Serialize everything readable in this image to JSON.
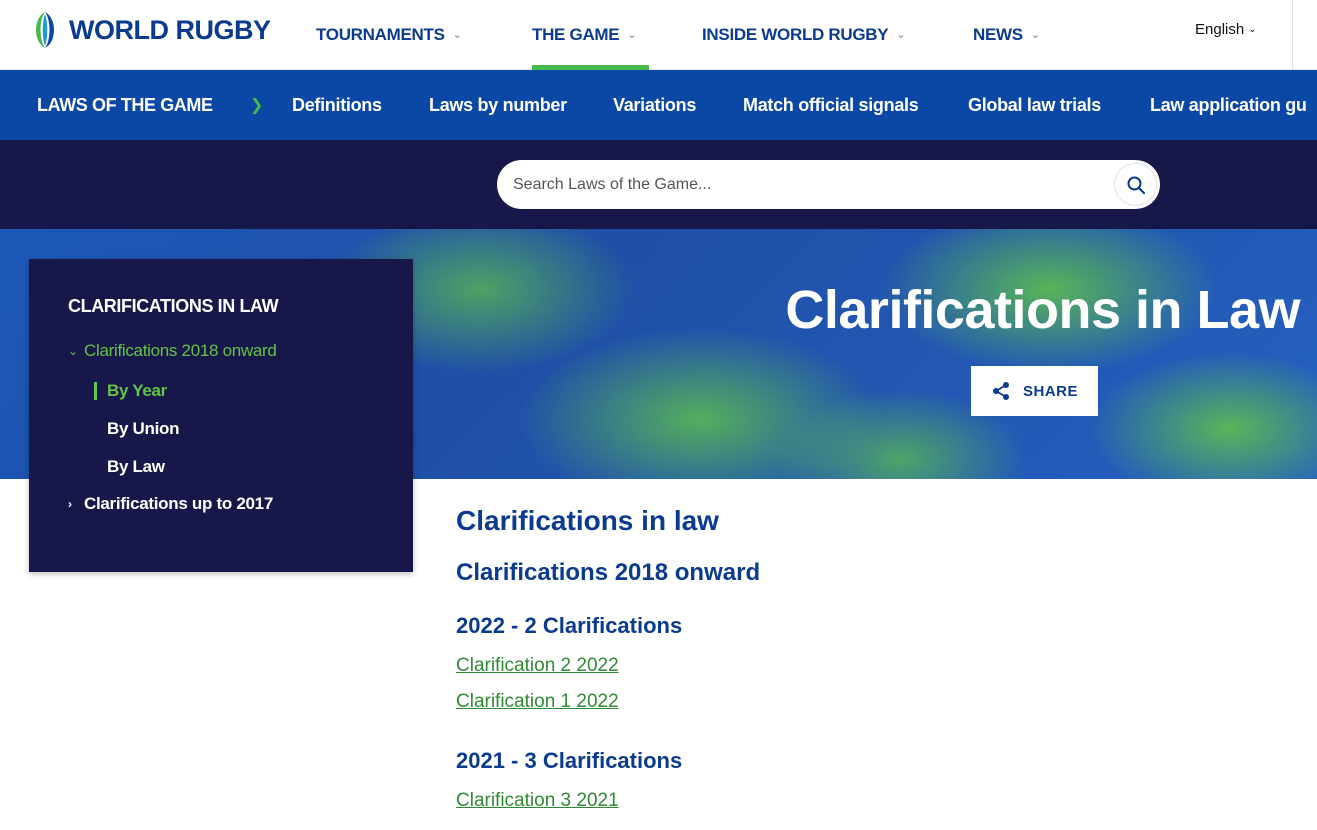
{
  "header": {
    "logo_text": "WORLD RUGBY",
    "nav": [
      {
        "label": "TOURNAMENTS"
      },
      {
        "label": "THE GAME"
      },
      {
        "label": "INSIDE WORLD RUGBY"
      },
      {
        "label": "NEWS"
      }
    ],
    "language": "English"
  },
  "laws_nav": {
    "title": "LAWS OF THE GAME",
    "links": [
      {
        "label": "Definitions"
      },
      {
        "label": "Laws by number"
      },
      {
        "label": "Variations"
      },
      {
        "label": "Match official signals"
      },
      {
        "label": "Global law trials"
      },
      {
        "label": "Law application gu"
      }
    ]
  },
  "search": {
    "placeholder": "Search Laws of the Game..."
  },
  "hero": {
    "title": "Clarifications in Law",
    "share_label": "SHARE"
  },
  "sidebar": {
    "title": "CLARIFICATIONS IN LAW",
    "items": [
      {
        "label": "Clarifications 2018 onward"
      },
      {
        "label": "By Year"
      },
      {
        "label": "By Union"
      },
      {
        "label": "By Law"
      },
      {
        "label": "Clarifications up to 2017"
      }
    ]
  },
  "content": {
    "title": "Clarifications in law",
    "subtitle": "Clarifications 2018 onward",
    "groups": [
      {
        "heading": "2022 - 2 Clarifications",
        "links": [
          "Clarification 2 2022",
          "Clarification 1 2022"
        ]
      },
      {
        "heading": "2021 - 3 Clarifications",
        "links": [
          "Clarification 3 2021"
        ]
      }
    ]
  },
  "colors": {
    "brand_blue": "#0b3b8f",
    "nav_blue": "#0b47a4",
    "navy": "#17174a",
    "accent_green": "#48b94c",
    "link_green": "#2f8a34"
  }
}
